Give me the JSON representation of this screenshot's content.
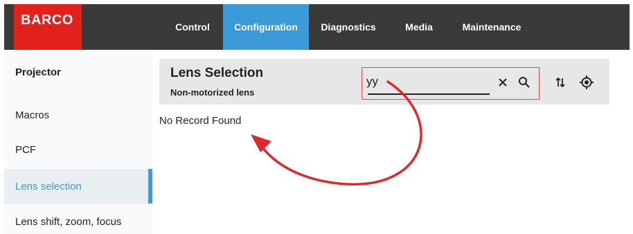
{
  "brand": {
    "logo_text": "BARCO",
    "accent": "#e2211c"
  },
  "nav": {
    "tabs": [
      {
        "label": "Control"
      },
      {
        "label": "Configuration",
        "active": true
      },
      {
        "label": "Diagnostics"
      },
      {
        "label": "Media"
      },
      {
        "label": "Maintenance"
      }
    ]
  },
  "sidebar": {
    "items": [
      {
        "label": "Projector"
      },
      {
        "label": "Macros"
      },
      {
        "label": "PCF"
      },
      {
        "label": "Lens selection",
        "active": true
      },
      {
        "label": "Lens shift, zoom, focus"
      }
    ]
  },
  "main": {
    "title": "Lens Selection",
    "subtitle": "Non-motorized lens",
    "search": {
      "value": "yy",
      "placeholder": ""
    },
    "empty_message": "No Record Found"
  },
  "colors": {
    "topbar": "#3a3a3a",
    "active_tab": "#3d9ad9",
    "header_bg": "#e7e7e7",
    "annotation": "#e0282a"
  },
  "icons": [
    "close-icon",
    "search-icon",
    "sort-icon",
    "locate-icon"
  ]
}
